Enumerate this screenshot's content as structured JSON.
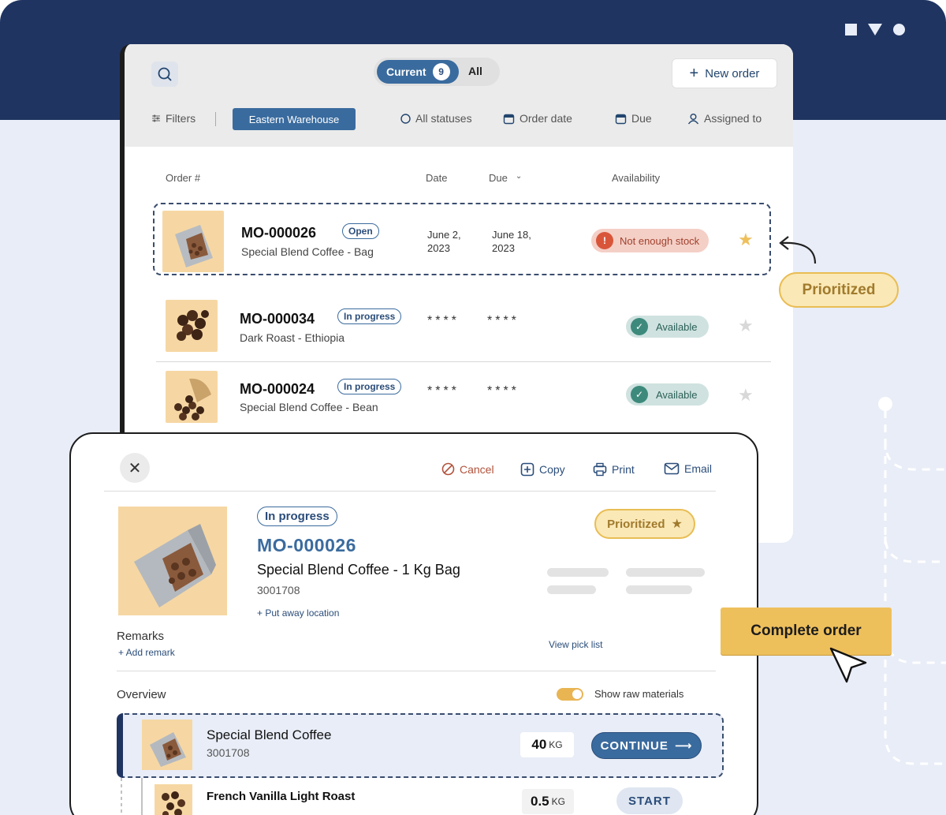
{
  "toolbar": {
    "tab_current": "Current",
    "current_count": "9",
    "tab_all": "All",
    "new_order": "New order"
  },
  "filters": {
    "label": "Filters",
    "warehouse": "Eastern Warehouse",
    "statuses": "All statuses",
    "order_date": "Order date",
    "due": "Due",
    "assigned_to": "Assigned to"
  },
  "table": {
    "headers": {
      "order": "Order #",
      "date": "Date",
      "due": "Due",
      "availability": "Availability"
    },
    "rows": [
      {
        "order": "MO-000026",
        "status": "Open",
        "product": "Special Blend Coffee - Bag",
        "date": "June 2, 2023",
        "due": "June 18, 2023",
        "availability": "Not enough stock",
        "starred": true
      },
      {
        "order": "MO-000034",
        "status": "In progress",
        "product": "Dark Roast - Ethiopia",
        "date": "****",
        "due": "****",
        "availability": "Available",
        "starred": false
      },
      {
        "order": "MO-000024",
        "status": "In progress",
        "product": "Special Blend Coffee - Bean",
        "date": "****",
        "due": "****",
        "availability": "Available",
        "starred": false
      }
    ]
  },
  "callout": {
    "prioritized": "Prioritized"
  },
  "detail": {
    "actions": {
      "cancel": "Cancel",
      "copy": "Copy",
      "print": "Print",
      "email": "Email"
    },
    "status": "In progress",
    "order_no": "MO-000026",
    "product_name": "Special Blend Coffee - 1 Kg Bag",
    "sku": "3001708",
    "put_away": "+ Put away location",
    "prioritized": "Prioritized",
    "remarks": "Remarks",
    "add_remark": "+ Add remark",
    "view_pick_list": "View pick list",
    "overview": "Overview",
    "show_raw": "Show raw materials",
    "show_raw_on": true,
    "items": [
      {
        "name": "Special Blend Coffee",
        "sku": "3001708",
        "qty": "40",
        "unit": "KG",
        "action": "CONTINUE"
      },
      {
        "name": "French Vanilla Light Roast",
        "qty": "0.5",
        "unit": "KG",
        "action": "START"
      }
    ]
  },
  "complete_order": "Complete order",
  "colors": {
    "navy": "#1f3461",
    "blue": "#3a6b9e",
    "gold": "#eec05c",
    "danger": "#d9553a",
    "success": "#3d8a7c"
  }
}
